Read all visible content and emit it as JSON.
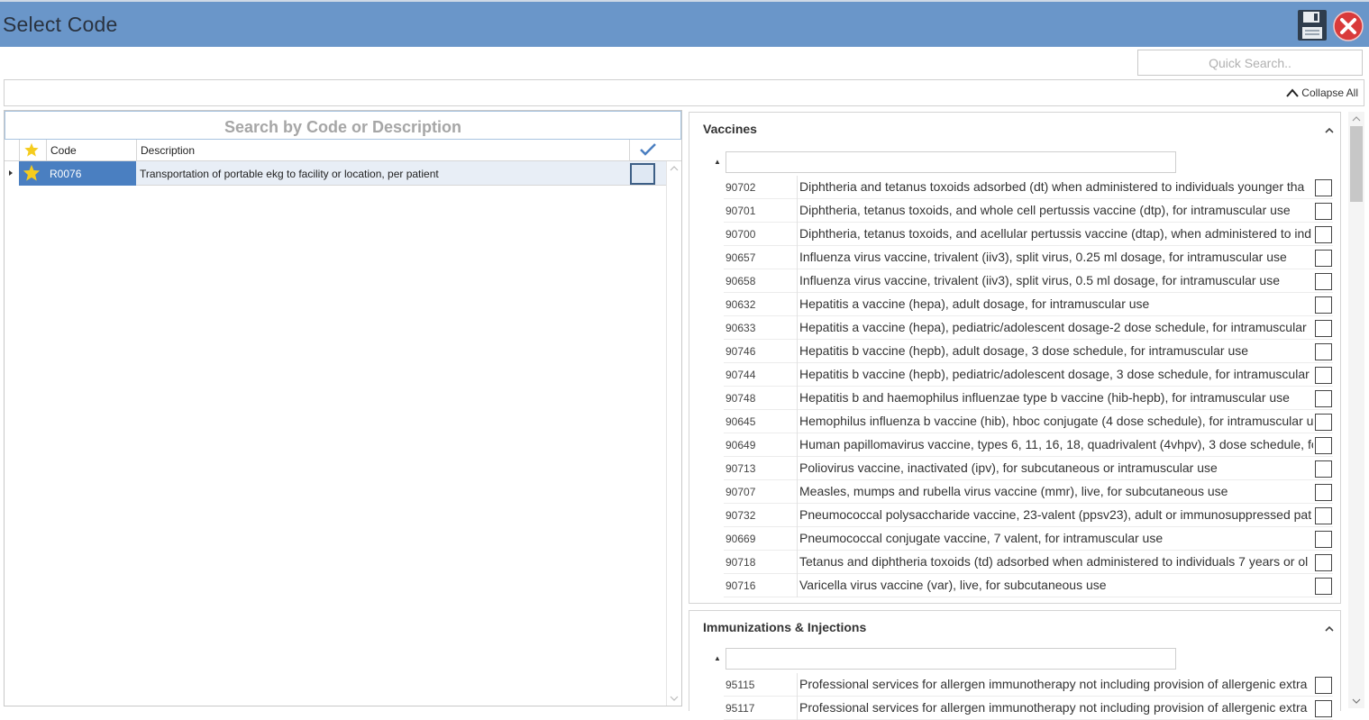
{
  "window": {
    "title": "Select Code"
  },
  "icons": {
    "save": "floppy-disk-icon",
    "close": "red-close-circle-icon",
    "star": "star-icon",
    "check": "checkmark-icon",
    "collapse": "chevron-up-icon"
  },
  "colors": {
    "titlebar": "#6a96c9",
    "selected_row": "#4a7fc1",
    "star": "#f5cc1e",
    "close": "#d93a3a"
  },
  "quick_search": {
    "placeholder": "Quick Search.."
  },
  "collapse_all": "Collapse All",
  "code_search": {
    "placeholder": "Search by Code or Description"
  },
  "grid": {
    "columns": {
      "code": "Code",
      "description": "Description"
    },
    "rows": [
      {
        "code": "R0076",
        "description": "Transportation of portable ekg to facility or location, per patient"
      }
    ]
  },
  "groups": [
    {
      "title": "Vaccines",
      "items": [
        {
          "code": "90702",
          "description": "Diphtheria and tetanus toxoids adsorbed (dt) when administered to individuals younger tha"
        },
        {
          "code": "90701",
          "description": "Diphtheria, tetanus toxoids, and whole cell pertussis vaccine (dtp), for intramuscular use"
        },
        {
          "code": "90700",
          "description": "Diphtheria, tetanus toxoids, and acellular pertussis vaccine (dtap), when administered to ind"
        },
        {
          "code": "90657",
          "description": "Influenza virus vaccine, trivalent (iiv3), split virus, 0.25 ml dosage, for intramuscular use"
        },
        {
          "code": "90658",
          "description": "Influenza virus vaccine, trivalent (iiv3), split virus, 0.5 ml dosage, for intramuscular use"
        },
        {
          "code": "90632",
          "description": "Hepatitis a vaccine (hepa), adult dosage, for intramuscular use"
        },
        {
          "code": "90633",
          "description": "Hepatitis a vaccine (hepa), pediatric/adolescent dosage-2 dose schedule, for intramuscular"
        },
        {
          "code": "90746",
          "description": "Hepatitis b vaccine (hepb), adult dosage, 3 dose schedule, for intramuscular use"
        },
        {
          "code": "90744",
          "description": "Hepatitis b vaccine (hepb), pediatric/adolescent dosage, 3 dose schedule, for intramuscular"
        },
        {
          "code": "90748",
          "description": "Hepatitis b and haemophilus influenzae type b vaccine (hib-hepb), for intramuscular use"
        },
        {
          "code": "90645",
          "description": "Hemophilus influenza b vaccine (hib), hboc conjugate (4 dose schedule), for intramuscular u"
        },
        {
          "code": "90649",
          "description": "Human papillomavirus vaccine, types 6, 11, 16, 18, quadrivalent (4vhpv), 3 dose schedule, for"
        },
        {
          "code": "90713",
          "description": "Poliovirus vaccine, inactivated (ipv), for subcutaneous or intramuscular use"
        },
        {
          "code": "90707",
          "description": "Measles, mumps and rubella virus vaccine (mmr), live, for subcutaneous use"
        },
        {
          "code": "90732",
          "description": "Pneumococcal polysaccharide vaccine, 23-valent (ppsv23), adult or immunosuppressed pat"
        },
        {
          "code": "90669",
          "description": "Pneumococcal conjugate vaccine, 7 valent, for intramuscular use"
        },
        {
          "code": "90718",
          "description": "Tetanus and diphtheria toxoids (td) adsorbed when administered to individuals 7 years or ol"
        },
        {
          "code": "90716",
          "description": "Varicella virus vaccine (var), live, for subcutaneous use"
        }
      ]
    },
    {
      "title": "Immunizations & Injections",
      "items": [
        {
          "code": "95115",
          "description": "Professional services for allergen immunotherapy not including provision of allergenic extra"
        },
        {
          "code": "95117",
          "description": "Professional services for allergen immunotherapy not including provision of allergenic extra"
        }
      ]
    }
  ]
}
